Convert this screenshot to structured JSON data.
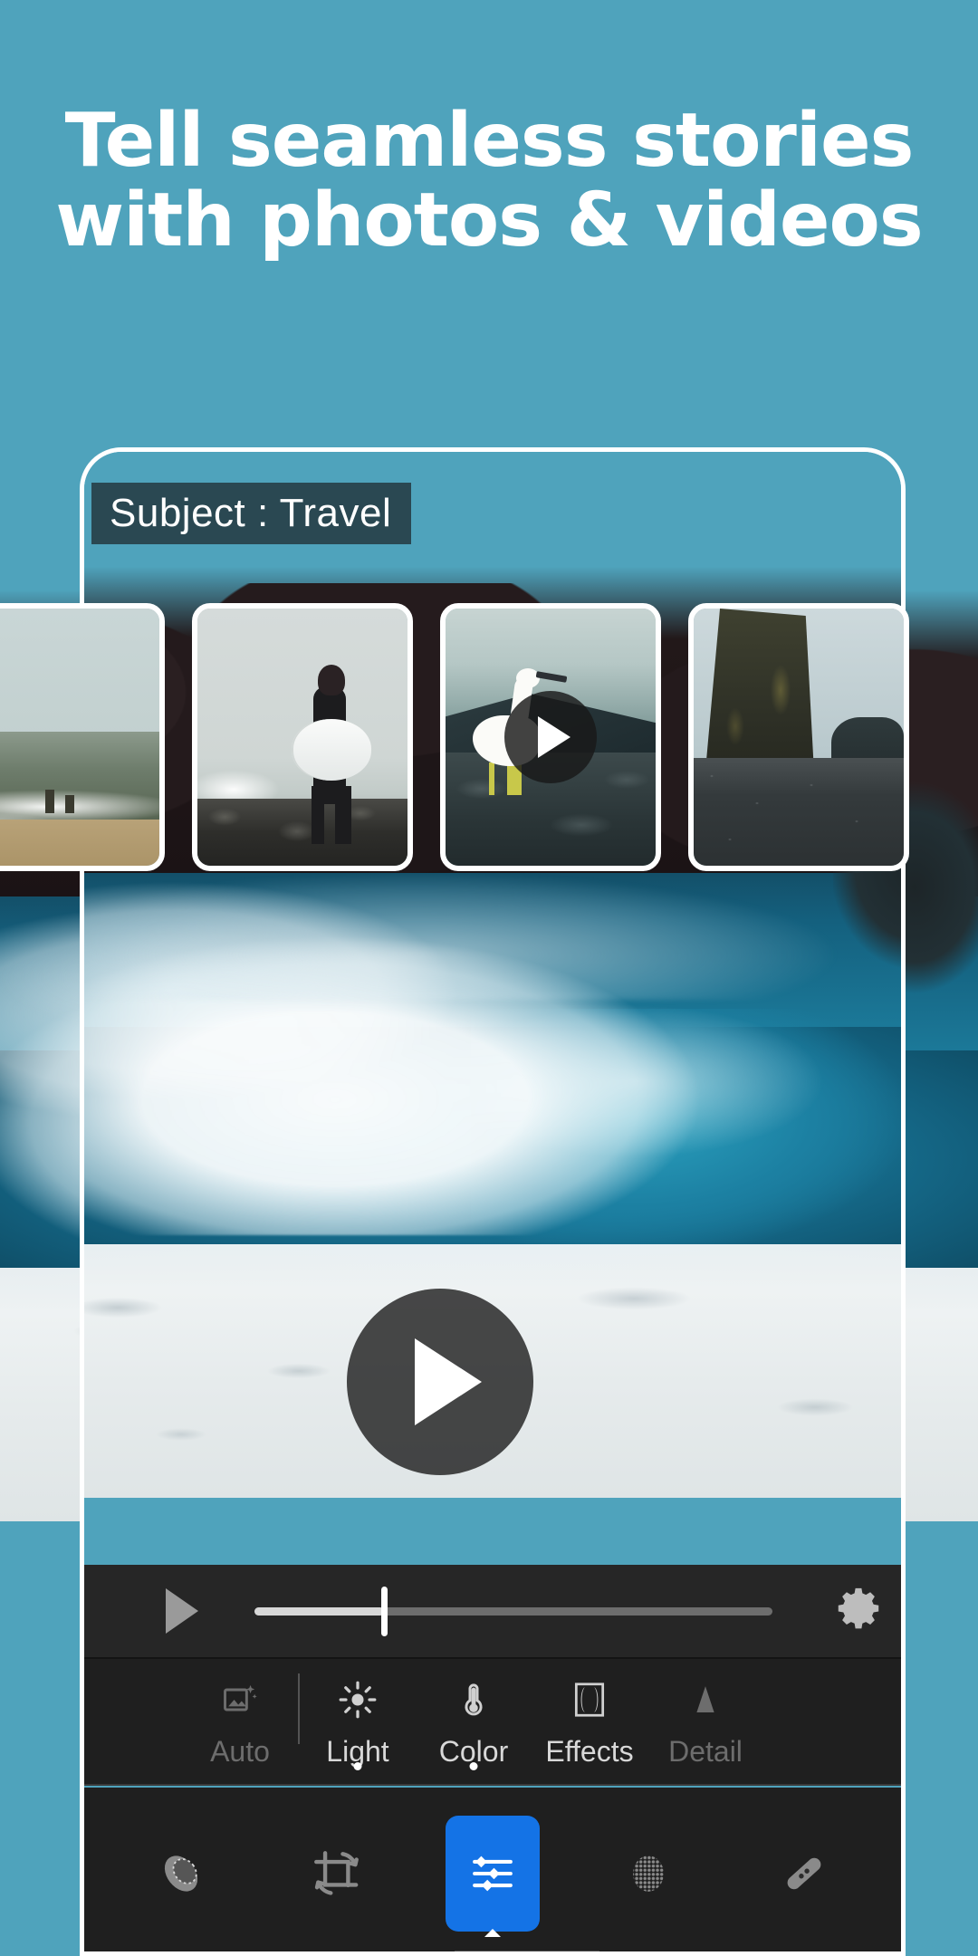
{
  "headline": {
    "line1": "Tell seamless stories",
    "line2": "with photos & videos"
  },
  "colors": {
    "background_teal": "#4FA3BC",
    "accent_blue": "#1473E6",
    "panel_dark": "#1F1F1F",
    "playbar_dark": "#262626",
    "badge_dark": "rgba(28,38,42,0.72)"
  },
  "phone": {
    "subject_badge": {
      "label": "Subject : Travel"
    },
    "filmstrip": {
      "items": [
        {
          "name": "stormy-beach-photo",
          "kind": "photo",
          "has_play": false
        },
        {
          "name": "surfer-with-board-photo",
          "kind": "photo",
          "has_play": false
        },
        {
          "name": "white-egret-video",
          "kind": "video",
          "has_play": true,
          "play_icon": "play-icon"
        },
        {
          "name": "black-sand-beach-photo",
          "kind": "photo",
          "has_play": false
        }
      ]
    },
    "preview": {
      "name": "ocean-wave-video",
      "play_icon": "play-icon"
    },
    "playback_bar": {
      "play_icon": "play-icon",
      "settings_icon": "gear-icon",
      "progress_percent": 25
    },
    "edit_tabs": [
      {
        "label": "Auto",
        "icon": "auto-enhance-icon",
        "state": "disabled",
        "indicator": false
      },
      {
        "label": "Light",
        "icon": "sun-icon",
        "state": "enabled",
        "indicator": true
      },
      {
        "label": "Color",
        "icon": "thermometer-icon",
        "state": "enabled",
        "indicator": true
      },
      {
        "label": "Effects",
        "icon": "vignette-icon",
        "state": "enabled",
        "indicator": false
      },
      {
        "label": "Detail",
        "icon": "triangle-icon",
        "state": "disabled",
        "indicator": false
      }
    ],
    "bottom_nav": [
      {
        "name": "presets-icon",
        "active": false
      },
      {
        "name": "crop-rotate-icon",
        "active": false
      },
      {
        "name": "edit-sliders-icon",
        "active": true
      },
      {
        "name": "texture-grain-icon",
        "active": false
      },
      {
        "name": "healing-brush-icon",
        "active": false
      }
    ]
  }
}
